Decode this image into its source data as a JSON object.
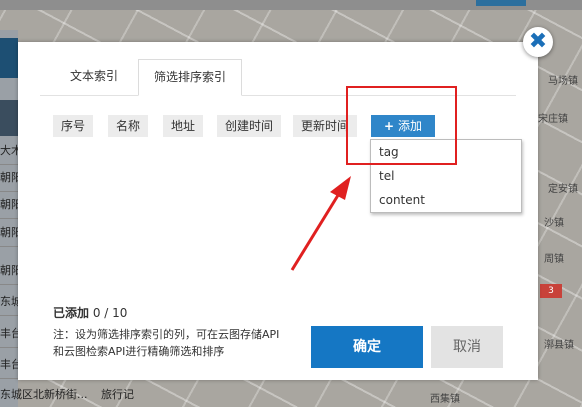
{
  "background": {
    "left_rows": [
      "大木",
      "朝阳",
      "朝阳",
      "朝阳",
      "朝阳",
      "东城",
      "丰台",
      "丰台",
      "东城"
    ],
    "places": [
      "马场镇",
      "定安镇",
      "沙镇",
      "周镇",
      "宋庄镇",
      "漷县镇",
      "西集镇"
    ],
    "bottom_texts": [
      "东城区北新桥街...",
      "旅行记"
    ],
    "badge": "3"
  },
  "modal": {
    "close_icon": "close-icon",
    "tabs": [
      {
        "label": "文本索引",
        "active": false
      },
      {
        "label": "筛选排序索引",
        "active": true
      }
    ],
    "columns": [
      "序号",
      "名称",
      "地址",
      "创建时间",
      "更新时间"
    ],
    "add_button": {
      "icon": "+",
      "label": "添加"
    },
    "dropdown_options": [
      "tag",
      "tel",
      "content"
    ],
    "count": {
      "label": "已添加",
      "value": "0 / 10"
    },
    "note": "注：设为筛选排序索引的列，可在云图存储API和云图检索API进行精确筛选和排序",
    "ok_label": "确定",
    "cancel_label": "取消",
    "annotation_color": "#e02020",
    "primary_color": "#1577c4"
  }
}
